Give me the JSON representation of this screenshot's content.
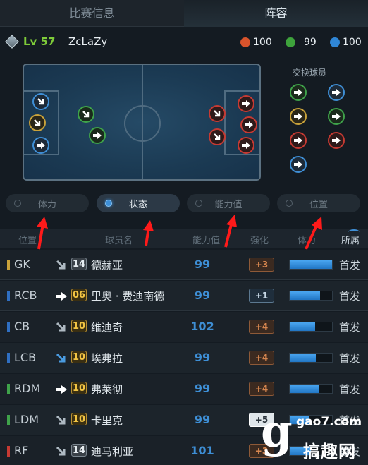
{
  "tabs": [
    {
      "label": "比赛信息",
      "active": false
    },
    {
      "label": "阵容",
      "active": true
    }
  ],
  "player": {
    "level": "Lv 57",
    "name": "ZcLaZy",
    "stats": [
      {
        "value": "100",
        "color": "#d9542c"
      },
      {
        "value": "99",
        "color": "#3ea33c"
      },
      {
        "value": "100",
        "color": "#2f86d6"
      }
    ]
  },
  "swap_title": "交换球员",
  "filters": [
    {
      "label": "体力",
      "active": false
    },
    {
      "label": "状态",
      "active": true
    },
    {
      "label": "能力值",
      "active": false
    },
    {
      "label": "位置",
      "active": false
    }
  ],
  "table": {
    "headers": {
      "position": "位置",
      "name": "球员名",
      "ability": "能力值",
      "boost": "强化",
      "stamina": "体力",
      "affiliation": "所属"
    },
    "rows": [
      {
        "pos": "GK",
        "pos_color": "#c9a23a",
        "move": "neutral",
        "number": "14",
        "num_style": "silver",
        "name": "德赫亚",
        "ability": "99",
        "boost": "+3",
        "boost_style": "orange",
        "stamina": 1.0,
        "role": "首发"
      },
      {
        "pos": "RCB",
        "pos_color": "#2f6fc2",
        "move": "up",
        "number": "06",
        "num_style": "gold",
        "name": "里奥 · 费迪南德",
        "ability": "99",
        "boost": "+1",
        "boost_style": "blue",
        "stamina": 0.72,
        "role": "首发"
      },
      {
        "pos": "CB",
        "pos_color": "#2f6fc2",
        "move": "neutral",
        "number": "10",
        "num_style": "gold",
        "name": "维迪奇",
        "ability": "102",
        "boost": "+4",
        "boost_style": "orange",
        "stamina": 0.6,
        "role": "首发"
      },
      {
        "pos": "LCB",
        "pos_color": "#2f6fc2",
        "move": "down",
        "number": "10",
        "num_style": "gold",
        "name": "埃弗拉",
        "ability": "99",
        "boost": "+4",
        "boost_style": "orange",
        "stamina": 0.62,
        "role": "首发"
      },
      {
        "pos": "RDM",
        "pos_color": "#3fa34a",
        "move": "up",
        "number": "10",
        "num_style": "gold",
        "name": "弗莱彻",
        "ability": "99",
        "boost": "+4",
        "boost_style": "orange",
        "stamina": 0.7,
        "role": "首发"
      },
      {
        "pos": "LDM",
        "pos_color": "#3fa34a",
        "move": "neutral",
        "number": "10",
        "num_style": "gold",
        "name": "卡里克",
        "ability": "99",
        "boost": "+5",
        "boost_style": "white",
        "stamina": 0.45,
        "role": "首发"
      },
      {
        "pos": "RF",
        "pos_color": "#c63a33",
        "move": "neutral",
        "number": "14",
        "num_style": "silver",
        "name": "迪马利亚",
        "ability": "101",
        "boost": "+3",
        "boost_style": "orange",
        "stamina": 0.5,
        "role": "首发"
      }
    ]
  },
  "watermark": {
    "logo": "g",
    "url": "gao7.com",
    "brand": "搞趣网"
  }
}
